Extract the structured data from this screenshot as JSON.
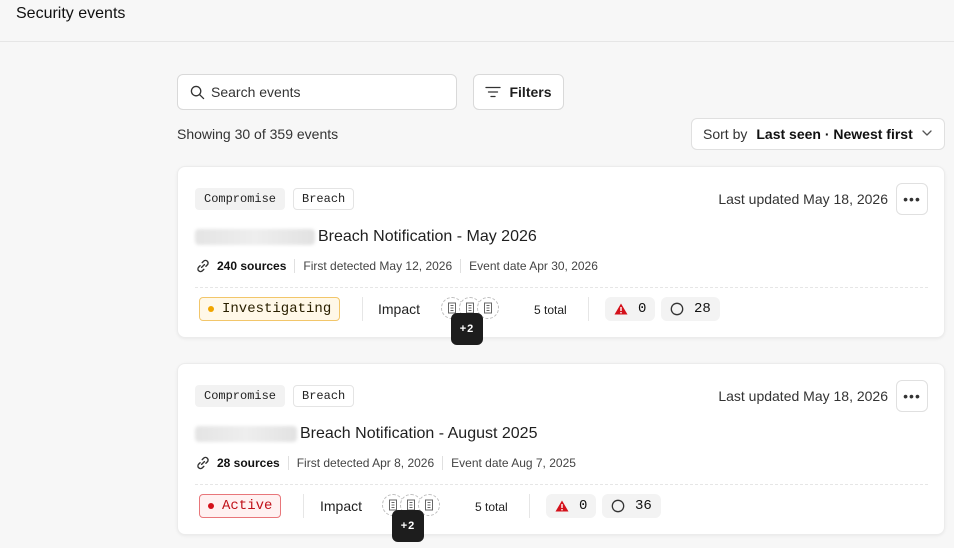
{
  "header": {
    "title": "Security events"
  },
  "search": {
    "placeholder": "Search events"
  },
  "filters": {
    "label": "Filters"
  },
  "results": {
    "summary": "Showing 30 of 359 events"
  },
  "sort": {
    "label": "Sort by",
    "value": "Last seen · Newest first"
  },
  "events": [
    {
      "tags": [
        "Compromise",
        "Breach"
      ],
      "updated": "Last updated May 18, 2026",
      "title": "Breach Notification - May 2026",
      "sources": "240 sources",
      "first_detected": "First detected May 12, 2026",
      "event_date": "Event date Apr 30, 2026",
      "status": "Investigating",
      "impact_label": "Impact",
      "impact_more": "+2",
      "impact_total": "5 total",
      "alerts": "0",
      "open": "28"
    },
    {
      "tags": [
        "Compromise",
        "Breach"
      ],
      "updated": "Last updated May 18, 2026",
      "title": "Breach Notification - August 2025",
      "sources": "28 sources",
      "first_detected": "First detected Apr 8, 2026",
      "event_date": "Event date Aug 7, 2025",
      "status": "Active",
      "impact_label": "Impact",
      "impact_more": "+2",
      "impact_total": "5 total",
      "alerts": "0",
      "open": "36"
    }
  ],
  "colors": {
    "investigating": "#f0a500",
    "active": "#d4111b",
    "alert": "#d4111b"
  }
}
